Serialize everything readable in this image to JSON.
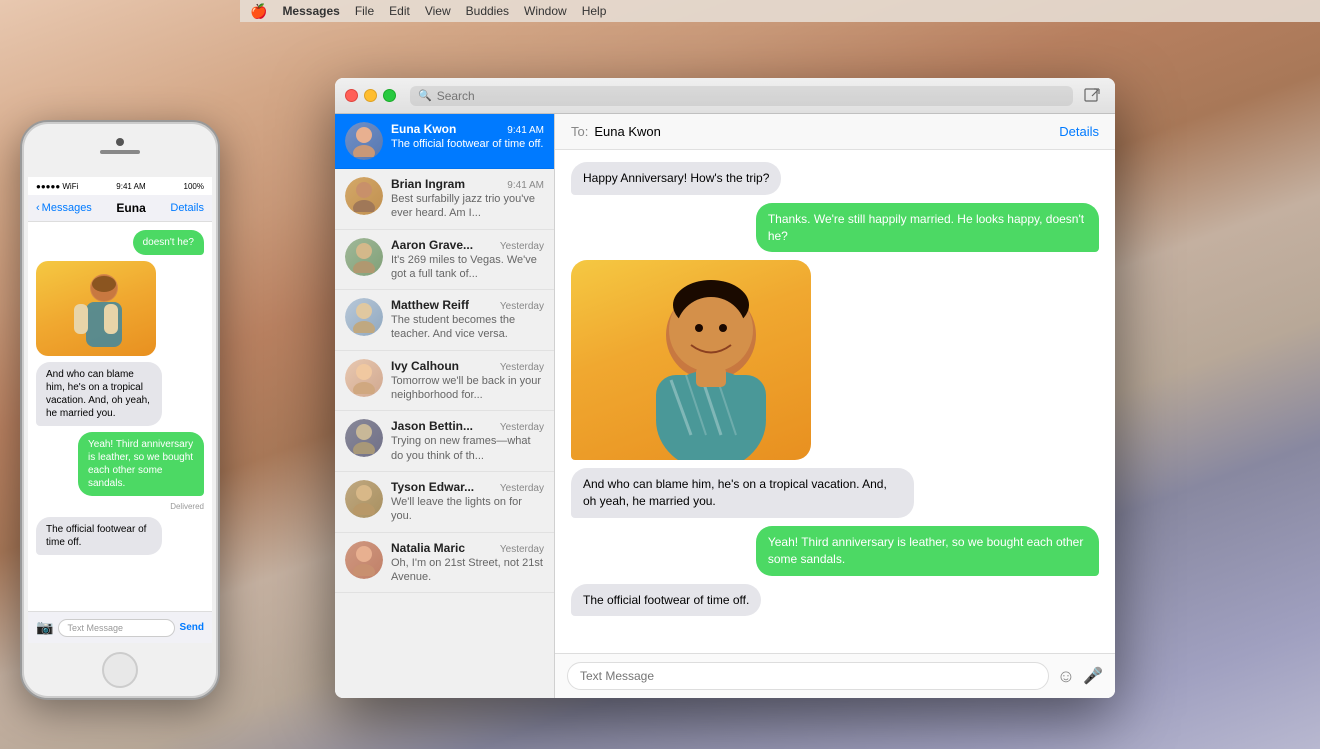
{
  "app": {
    "title": "Messages",
    "menubar": {
      "apple": "🍎",
      "items": [
        "Messages",
        "File",
        "Edit",
        "View",
        "Buddies",
        "Window",
        "Help"
      ]
    }
  },
  "iphone": {
    "status_bar": {
      "signal": "●●●●●",
      "wifi": "WiFi",
      "time": "9:41 AM",
      "battery": "100%"
    },
    "nav": {
      "back_label": "Messages",
      "contact_name": "Euna",
      "details_label": "Details"
    },
    "messages": [
      {
        "type": "outgoing",
        "text": "doesn't he?"
      },
      {
        "type": "image"
      },
      {
        "type": "incoming",
        "text": "And who can blame him, he's on a tropical vacation. And, oh yeah, he married you."
      },
      {
        "type": "outgoing",
        "text": "Yeah! Third anniversary is leather, so we bought each other some sandals."
      },
      {
        "type": "delivered_label",
        "text": "Delivered"
      },
      {
        "type": "incoming",
        "text": "The official footwear of time off."
      }
    ],
    "input": {
      "placeholder": "Text Message",
      "send_label": "Send"
    }
  },
  "sidebar": {
    "search_placeholder": "Search",
    "contacts": [
      {
        "name": "Euna Kwon",
        "time": "9:41 AM",
        "preview": "The official footwear of time off.",
        "active": true
      },
      {
        "name": "Brian Ingram",
        "time": "9:41 AM",
        "preview": "Best surfabilly jazz trio you've ever heard. Am I...",
        "active": false
      },
      {
        "name": "Aaron Grave...",
        "time": "Yesterday",
        "preview": "It's 269 miles to Vegas. We've got a full tank of...",
        "active": false
      },
      {
        "name": "Matthew Reiff",
        "time": "Yesterday",
        "preview": "The student becomes the teacher. And vice versa.",
        "active": false
      },
      {
        "name": "Ivy Calhoun",
        "time": "Yesterday",
        "preview": "Tomorrow we'll be back in your neighborhood for...",
        "active": false
      },
      {
        "name": "Jason Bettin...",
        "time": "Yesterday",
        "preview": "Trying on new frames—what do you think of th...",
        "active": false
      },
      {
        "name": "Tyson Edwar...",
        "time": "Yesterday",
        "preview": "We'll leave the lights on for you.",
        "active": false
      },
      {
        "name": "Natalia Maric",
        "time": "Yesterday",
        "preview": "Oh, I'm on 21st Street, not 21st Avenue.",
        "active": false
      }
    ]
  },
  "chat": {
    "to_label": "To:",
    "contact_name": "Euna Kwon",
    "details_label": "Details",
    "messages": [
      {
        "type": "incoming",
        "text": "Happy Anniversary! How's the trip?"
      },
      {
        "type": "outgoing",
        "text": "Thanks. We're still happily married. He looks happy, doesn't he?"
      },
      {
        "type": "image"
      },
      {
        "type": "incoming",
        "text": "And who can blame him, he's on a tropical vacation. And, oh yeah, he married you."
      },
      {
        "type": "outgoing",
        "text": "Yeah! Third anniversary is leather, so we bought each other some sandals."
      },
      {
        "type": "incoming",
        "text": "The official footwear of time off."
      }
    ],
    "input_placeholder": "Text Message"
  }
}
